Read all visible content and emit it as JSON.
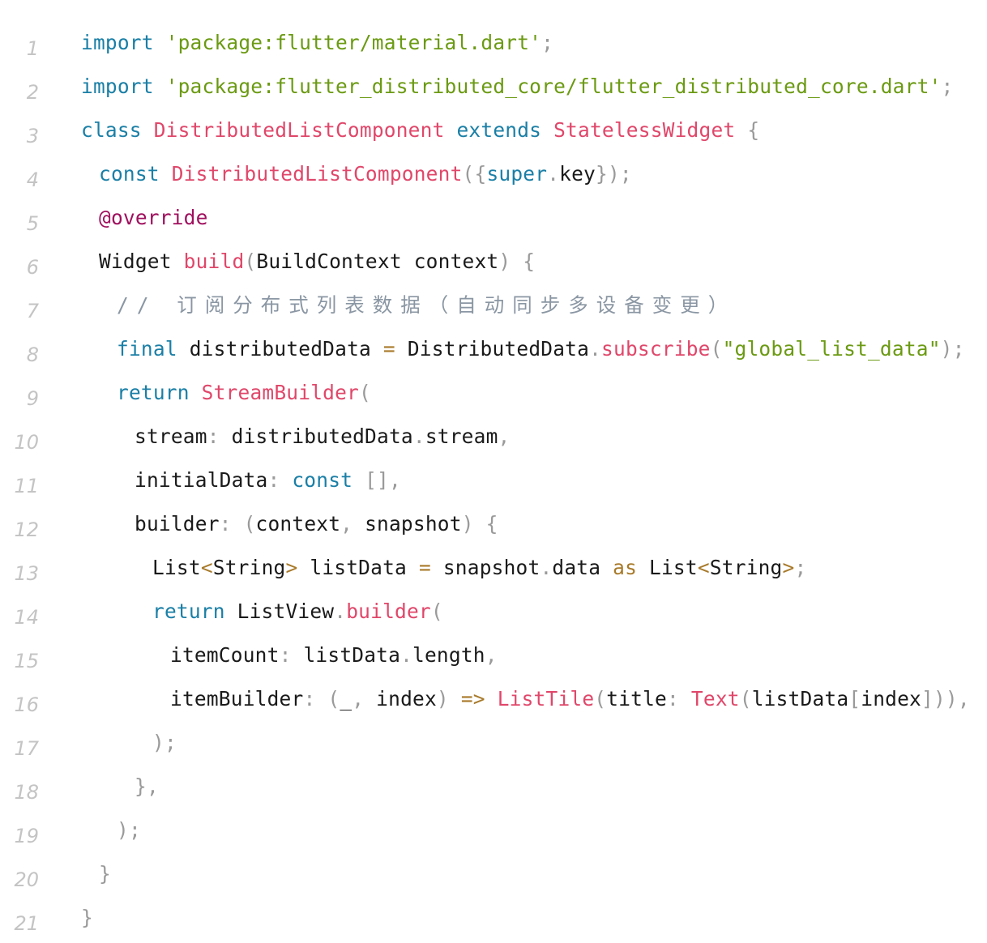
{
  "editor": {
    "lines": [
      {
        "n": "1",
        "indent": 0,
        "tokens": [
          [
            "kw",
            "import"
          ],
          [
            "def",
            " "
          ],
          [
            "str",
            "'package:flutter/material.dart'"
          ],
          [
            "pun",
            ";"
          ]
        ]
      },
      {
        "n": "2",
        "indent": 0,
        "tokens": [
          [
            "kw",
            "import"
          ],
          [
            "def",
            " "
          ],
          [
            "str",
            "'package:flutter_distributed_core/flutter_distributed_core.dart'"
          ],
          [
            "pun",
            ";"
          ]
        ]
      },
      {
        "n": "3",
        "indent": 0,
        "tokens": [
          [
            "kw",
            "class"
          ],
          [
            "def",
            " "
          ],
          [
            "cls",
            "DistributedListComponent"
          ],
          [
            "def",
            " "
          ],
          [
            "kw",
            "extends"
          ],
          [
            "def",
            " "
          ],
          [
            "cls",
            "StatelessWidget"
          ],
          [
            "def",
            " "
          ],
          [
            "pun",
            "{"
          ]
        ]
      },
      {
        "n": "4",
        "indent": 1,
        "tokens": [
          [
            "kw",
            "const"
          ],
          [
            "def",
            " "
          ],
          [
            "cls",
            "DistributedListComponent"
          ],
          [
            "pun",
            "({"
          ],
          [
            "kw",
            "super"
          ],
          [
            "pun",
            "."
          ],
          [
            "def",
            "key"
          ],
          [
            "pun",
            "});"
          ]
        ]
      },
      {
        "n": "5",
        "indent": 1,
        "tokens": [
          [
            "ann",
            "@override"
          ]
        ]
      },
      {
        "n": "6",
        "indent": 1,
        "tokens": [
          [
            "def",
            "Widget "
          ],
          [
            "fn",
            "build"
          ],
          [
            "pun",
            "("
          ],
          [
            "def",
            "BuildContext context"
          ],
          [
            "pun",
            ")"
          ],
          [
            "def",
            " "
          ],
          [
            "pun",
            "{"
          ]
        ]
      },
      {
        "n": "7",
        "indent": 2,
        "tokens": [
          [
            "cmt",
            "// 订阅分布式列表数据（自动同步多设备变更）"
          ]
        ]
      },
      {
        "n": "8",
        "indent": 2,
        "tokens": [
          [
            "kw",
            "final"
          ],
          [
            "def",
            " distributedData "
          ],
          [
            "op",
            "="
          ],
          [
            "def",
            " DistributedData"
          ],
          [
            "pun",
            "."
          ],
          [
            "fn",
            "subscribe"
          ],
          [
            "pun",
            "("
          ],
          [
            "str",
            "\"global_list_data\""
          ],
          [
            "pun",
            ");"
          ]
        ]
      },
      {
        "n": "9",
        "indent": 2,
        "tokens": [
          [
            "kw",
            "return"
          ],
          [
            "def",
            " "
          ],
          [
            "cls",
            "StreamBuilder"
          ],
          [
            "pun",
            "("
          ]
        ]
      },
      {
        "n": "10",
        "indent": 3,
        "tokens": [
          [
            "def",
            "stream"
          ],
          [
            "pun",
            ":"
          ],
          [
            "def",
            " distributedData"
          ],
          [
            "pun",
            "."
          ],
          [
            "def",
            "stream"
          ],
          [
            "pun",
            ","
          ]
        ]
      },
      {
        "n": "11",
        "indent": 3,
        "tokens": [
          [
            "def",
            "initialData"
          ],
          [
            "pun",
            ":"
          ],
          [
            "def",
            " "
          ],
          [
            "kw",
            "const"
          ],
          [
            "def",
            " "
          ],
          [
            "pun",
            "[],"
          ]
        ]
      },
      {
        "n": "12",
        "indent": 3,
        "tokens": [
          [
            "def",
            "builder"
          ],
          [
            "pun",
            ":"
          ],
          [
            "def",
            " "
          ],
          [
            "pun",
            "("
          ],
          [
            "def",
            "context"
          ],
          [
            "pun",
            ","
          ],
          [
            "def",
            " snapshot"
          ],
          [
            "pun",
            ")"
          ],
          [
            "def",
            " "
          ],
          [
            "pun",
            "{"
          ]
        ]
      },
      {
        "n": "13",
        "indent": 4,
        "tokens": [
          [
            "def",
            "List"
          ],
          [
            "op",
            "<"
          ],
          [
            "def",
            "String"
          ],
          [
            "op",
            ">"
          ],
          [
            "def",
            " listData "
          ],
          [
            "op",
            "="
          ],
          [
            "def",
            " snapshot"
          ],
          [
            "pun",
            "."
          ],
          [
            "def",
            "data "
          ],
          [
            "op",
            "as"
          ],
          [
            "def",
            " List"
          ],
          [
            "op",
            "<"
          ],
          [
            "def",
            "String"
          ],
          [
            "op",
            ">"
          ],
          [
            "pun",
            ";"
          ]
        ]
      },
      {
        "n": "14",
        "indent": 4,
        "tokens": [
          [
            "kw",
            "return"
          ],
          [
            "def",
            " ListView"
          ],
          [
            "pun",
            "."
          ],
          [
            "fn",
            "builder"
          ],
          [
            "pun",
            "("
          ]
        ]
      },
      {
        "n": "15",
        "indent": 5,
        "tokens": [
          [
            "def",
            "itemCount"
          ],
          [
            "pun",
            ":"
          ],
          [
            "def",
            " listData"
          ],
          [
            "pun",
            "."
          ],
          [
            "def",
            "length"
          ],
          [
            "pun",
            ","
          ]
        ]
      },
      {
        "n": "16",
        "indent": 5,
        "tokens": [
          [
            "def",
            "itemBuilder"
          ],
          [
            "pun",
            ":"
          ],
          [
            "def",
            " "
          ],
          [
            "pun",
            "("
          ],
          [
            "def",
            "_"
          ],
          [
            "pun",
            ","
          ],
          [
            "def",
            " index"
          ],
          [
            "pun",
            ")"
          ],
          [
            "def",
            " "
          ],
          [
            "op",
            "=>"
          ],
          [
            "def",
            " "
          ],
          [
            "cls",
            "ListTile"
          ],
          [
            "pun",
            "("
          ],
          [
            "def",
            "title"
          ],
          [
            "pun",
            ":"
          ],
          [
            "def",
            " "
          ],
          [
            "cls",
            "Text"
          ],
          [
            "pun",
            "("
          ],
          [
            "def",
            "listData"
          ],
          [
            "pun",
            "["
          ],
          [
            "def",
            "index"
          ],
          [
            "pun",
            "])),"
          ]
        ]
      },
      {
        "n": "17",
        "indent": 4,
        "tokens": [
          [
            "pun",
            ");"
          ]
        ]
      },
      {
        "n": "18",
        "indent": 3,
        "tokens": [
          [
            "pun",
            "},"
          ]
        ]
      },
      {
        "n": "19",
        "indent": 2,
        "tokens": [
          [
            "pun",
            ");"
          ]
        ]
      },
      {
        "n": "20",
        "indent": 1,
        "tokens": [
          [
            "pun",
            "}"
          ]
        ]
      },
      {
        "n": "21",
        "indent": 0,
        "tokens": [
          [
            "pun",
            "}"
          ]
        ]
      }
    ]
  },
  "colors": {
    "background": "#ffffff",
    "keyword": "#1a7fa6",
    "string": "#6b9a12",
    "class_name": "#e0476a",
    "function": "#e0476a",
    "punctuation": "#9a9a9a",
    "annotation": "#a0105e",
    "comment": "#8a96a3",
    "operator": "#a87a2a",
    "default": "#1a1a1a",
    "line_number": "#c4c4c4"
  }
}
